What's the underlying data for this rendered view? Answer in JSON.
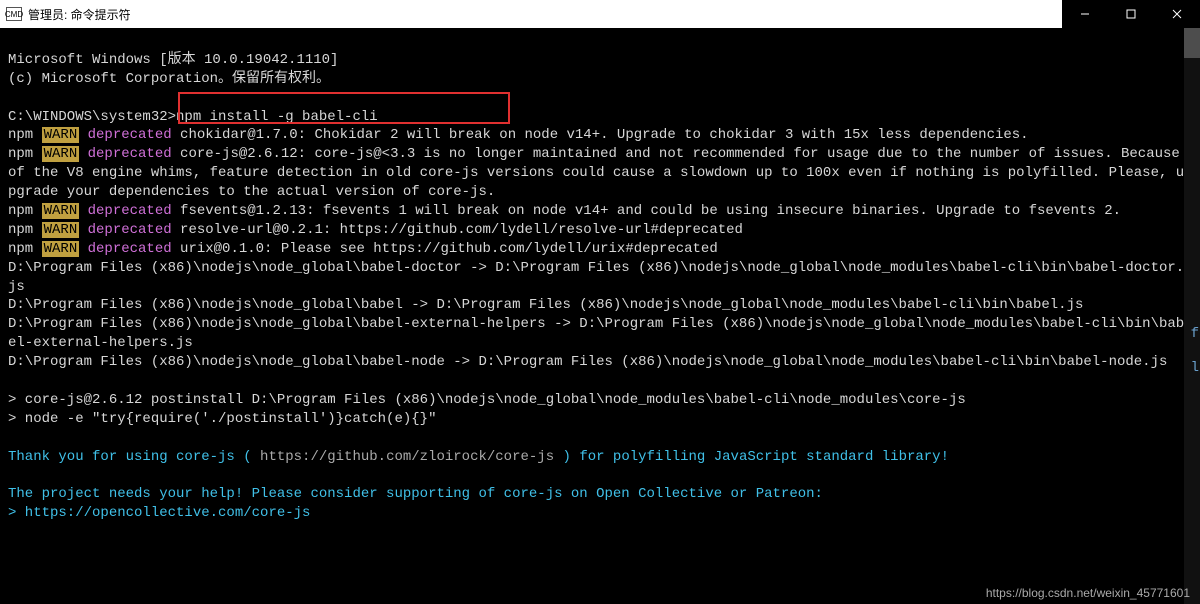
{
  "titlebar": {
    "icon_label": "CMD",
    "title": "管理员: 命令提示符"
  },
  "terminal": {
    "line1": "Microsoft Windows [版本 10.0.19042.1110]",
    "line2": "(c) Microsoft Corporation。保留所有权利。",
    "prompt": "C:\\WINDOWS\\system32>",
    "cmd": "npm install -g babel-cli",
    "npm": "npm ",
    "warn": "WARN",
    "deprecated": " deprecated",
    "w1_rest": " chokidar@1.7.0: Chokidar 2 will break on node v14+. Upgrade to chokidar 3 with 15x less dependencies.",
    "w2_rest": " core-js@2.6.12: core-js@<3.3 is no longer maintained and not recommended for usage due to the number of issues. Because of the V8 engine whims, feature detection in old core-js versions could cause a slowdown up to 100x even if nothing is polyfilled. Please, upgrade your dependencies to the actual version of core-js.",
    "w3_rest": " fsevents@1.2.13: fsevents 1 will break on node v14+ and could be using insecure binaries. Upgrade to fsevents 2.",
    "w4_rest": " resolve-url@0.2.1: https://github.com/lydell/resolve-url#deprecated",
    "w5_rest": " urix@0.1.0: Please see https://github.com/lydell/urix#deprecated",
    "path1": "D:\\Program Files (x86)\\nodejs\\node_global\\babel-doctor -> D:\\Program Files (x86)\\nodejs\\node_global\\node_modules\\babel-cli\\bin\\babel-doctor.js",
    "path2": "D:\\Program Files (x86)\\nodejs\\node_global\\babel -> D:\\Program Files (x86)\\nodejs\\node_global\\node_modules\\babel-cli\\bin\\babel.js",
    "path3": "D:\\Program Files (x86)\\nodejs\\node_global\\babel-external-helpers -> D:\\Program Files (x86)\\nodejs\\node_global\\node_modules\\babel-cli\\bin\\babel-external-helpers.js",
    "path4": "D:\\Program Files (x86)\\nodejs\\node_global\\babel-node -> D:\\Program Files (x86)\\nodejs\\node_global\\node_modules\\babel-cli\\bin\\babel-node.js",
    "post1": "> core-js@2.6.12 postinstall D:\\Program Files (x86)\\nodejs\\node_global\\node_modules\\babel-cli\\node_modules\\core-js",
    "post2": "> node -e \"try{require('./postinstall')}catch(e){}\"",
    "thank_pre": "Thank you for using core-js ( ",
    "thank_url": "https://github.com/zloirock/core-js",
    "thank_post": " ) for polyfilling JavaScript standard library!",
    "support": "The project needs your help! Please consider supporting of core-js on Open Collective or Patreon:",
    "support_url": "> https://opencollective.com/core-js"
  },
  "watermark": "https://blog.csdn.net/weixin_45771601",
  "sidebar": {
    "f": "f",
    "l": "l"
  }
}
